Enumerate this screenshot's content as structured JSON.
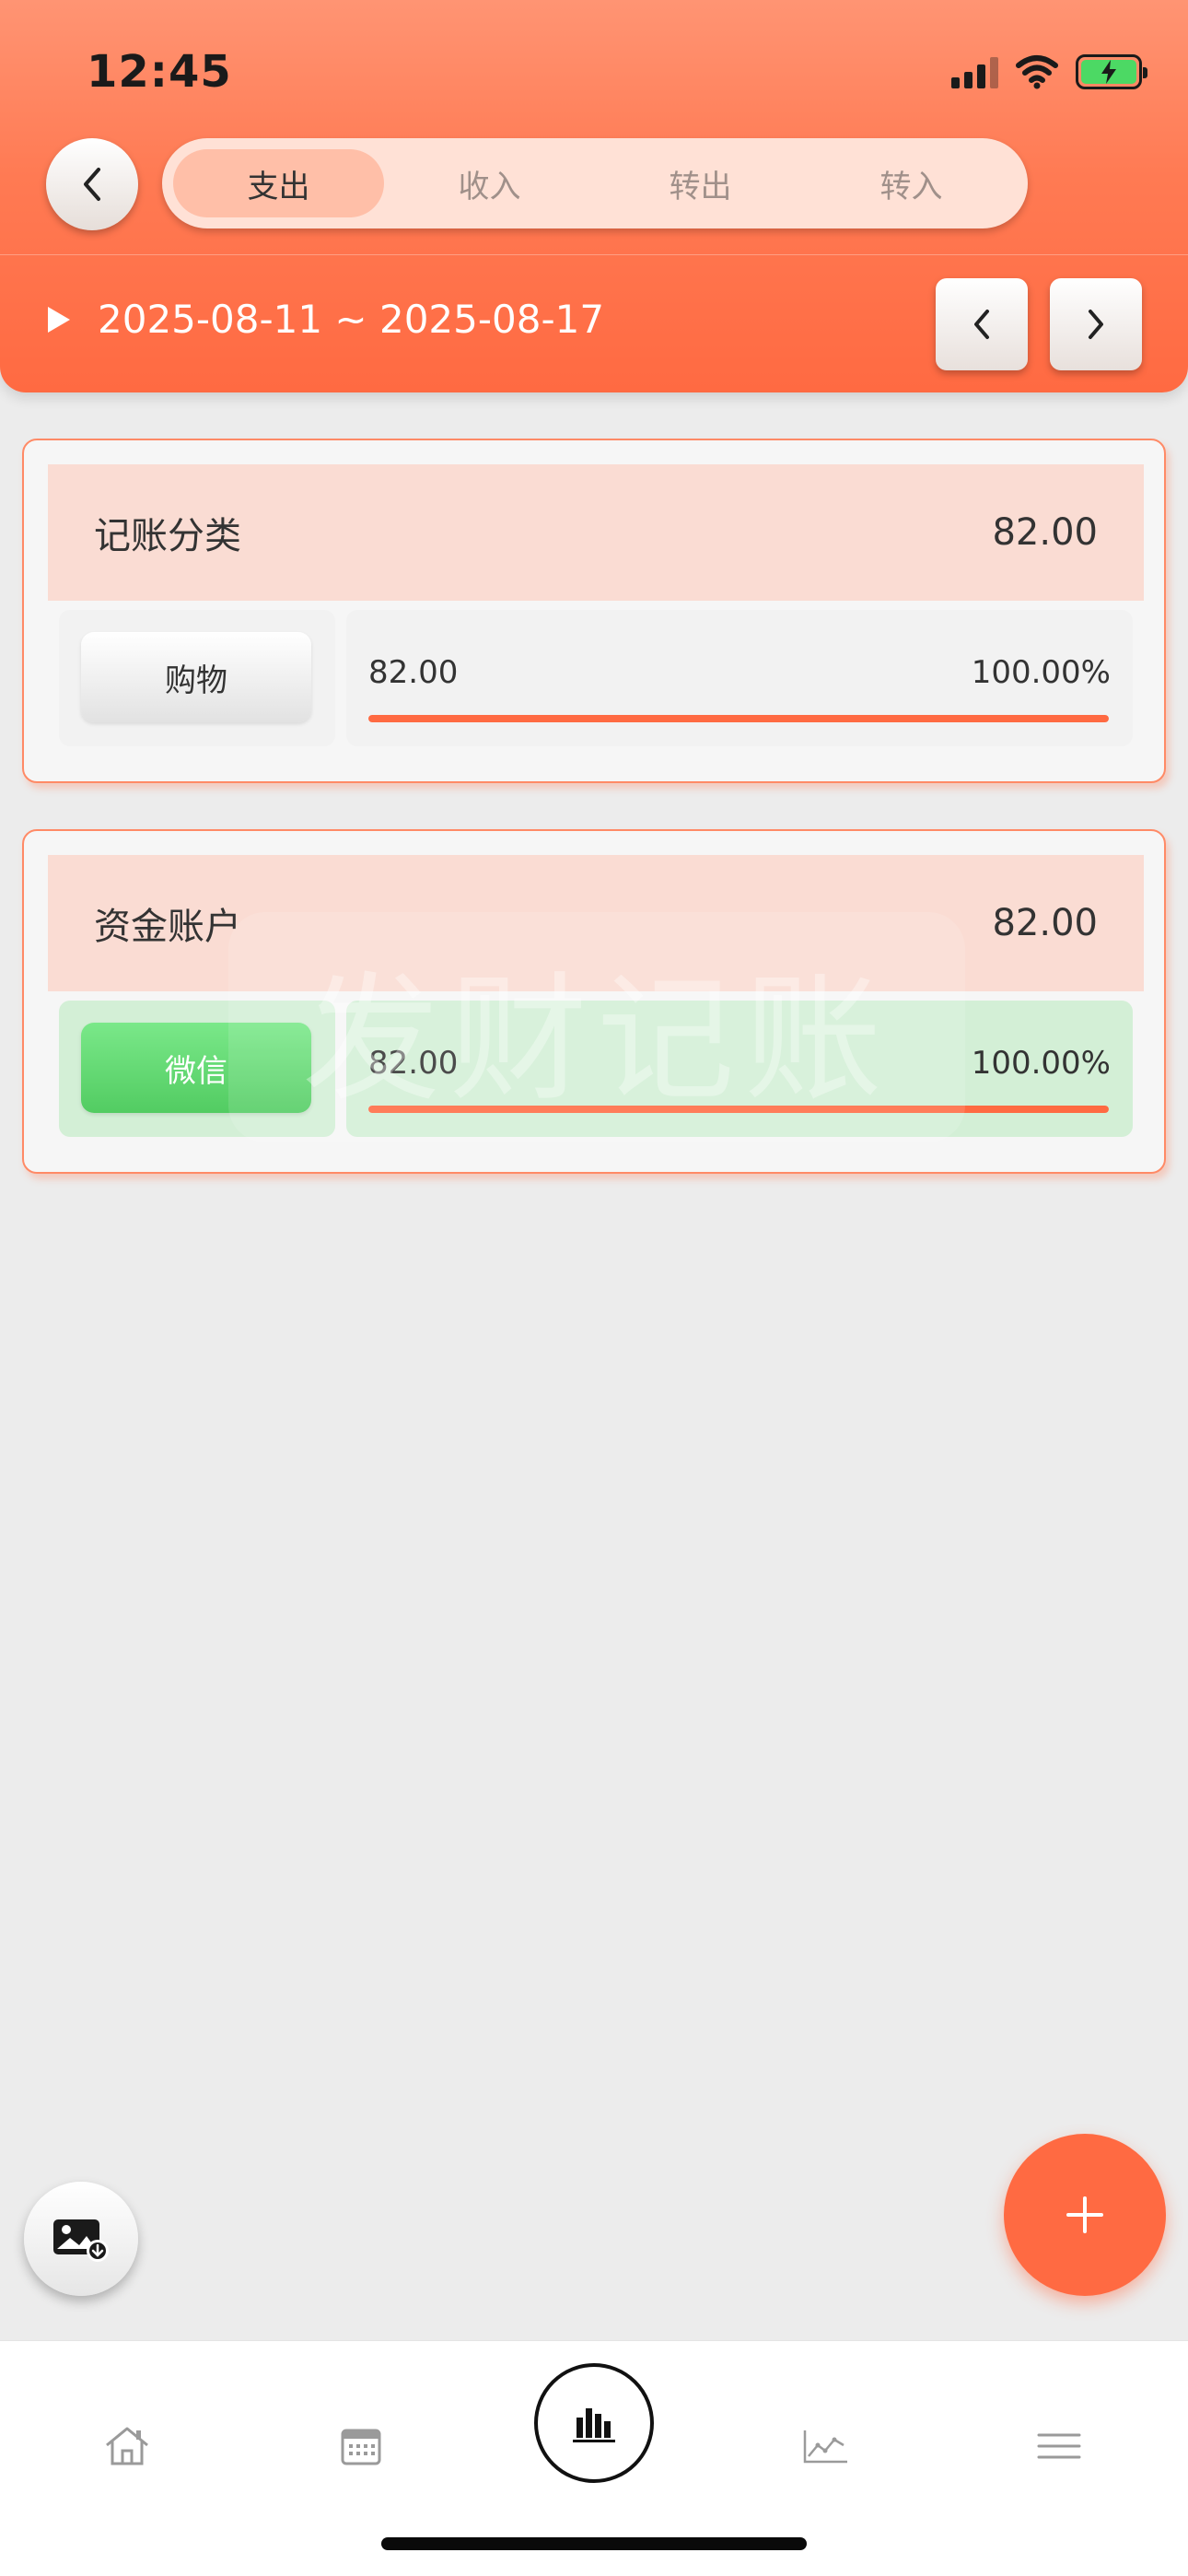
{
  "status_bar": {
    "time": "12:45"
  },
  "tabs": [
    {
      "label": "支出",
      "active": true
    },
    {
      "label": "收入",
      "active": false
    },
    {
      "label": "转出",
      "active": false
    },
    {
      "label": "转入",
      "active": false
    }
  ],
  "date_range": {
    "text": "2025-08-11 ~ 2025-08-17"
  },
  "category_card": {
    "title": "记账分类",
    "total": "82.00",
    "rows": [
      {
        "label": "购物",
        "amount": "82.00",
        "percent": "100.00%",
        "fraction": 1.0
      }
    ]
  },
  "account_card": {
    "title": "资金账户",
    "total": "82.00",
    "rows": [
      {
        "label": "微信",
        "amount": "82.00",
        "percent": "100.00%",
        "fraction": 1.0
      }
    ]
  },
  "watermark": "发财记账",
  "colors": {
    "accent": "#ff6a42",
    "tab_bg": "#ffe1d6",
    "tab_active": "#ffbfa8",
    "card_head": "#fadcd3",
    "green": "#52cc62"
  },
  "icons": {
    "back": "chevron-left-icon",
    "prev": "chevron-left-icon",
    "next": "chevron-right-icon",
    "expand": "play-triangle-icon",
    "image_export": "image-download-icon",
    "add": "plus-icon",
    "nav": [
      "home-icon",
      "calendar-icon",
      "bar-chart-icon",
      "line-chart-icon",
      "menu-icon"
    ]
  }
}
